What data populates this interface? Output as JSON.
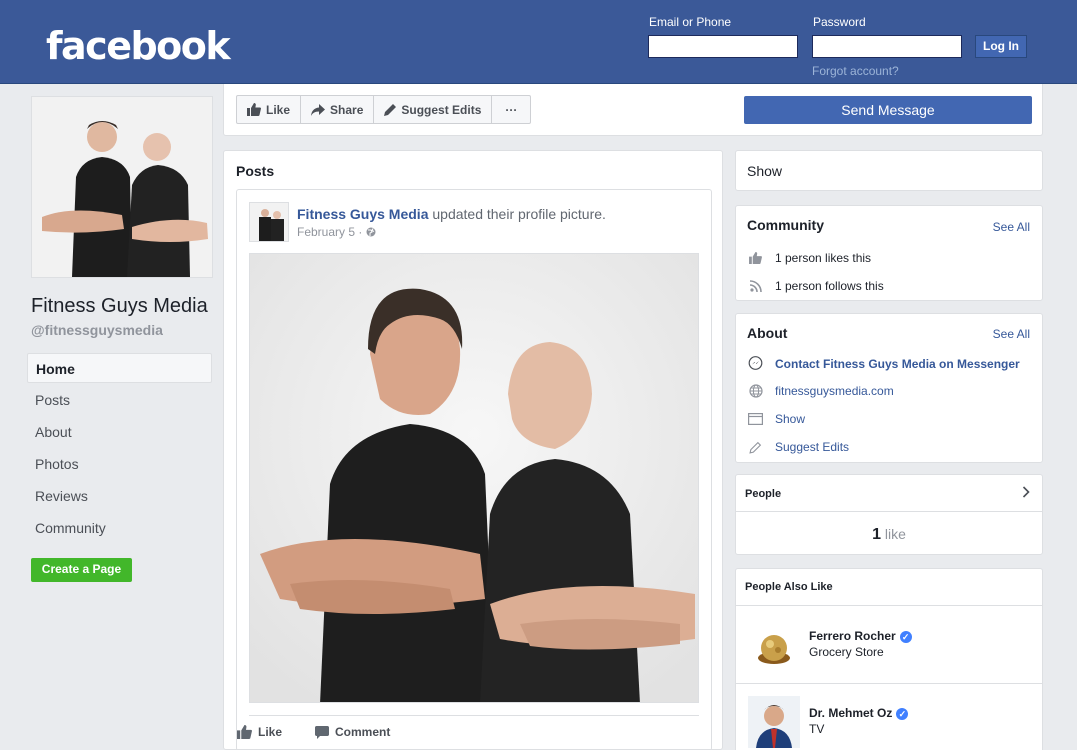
{
  "header": {
    "logo": "facebook",
    "email_label": "Email or Phone",
    "password_label": "Password",
    "login_button": "Log In",
    "forgot_link": "Forgot account?"
  },
  "page": {
    "name": "Fitness Guys Media",
    "handle": "@fitnessguysmedia"
  },
  "nav": {
    "items": [
      "Home",
      "Posts",
      "About",
      "Photos",
      "Reviews",
      "Community"
    ],
    "active": "Home",
    "create_page": "Create a Page"
  },
  "actions": {
    "like": "Like",
    "share": "Share",
    "suggest": "Suggest Edits",
    "more": "···",
    "send_message": "Send Message"
  },
  "posts": {
    "title": "Posts",
    "post": {
      "author": "Fitness Guys Media",
      "action": "updated their profile picture.",
      "date": "February 5 · ",
      "like": "Like",
      "comment": "Comment"
    }
  },
  "right": {
    "show": "Show",
    "community": {
      "title": "Community",
      "see_all": "See All",
      "likes": "1 person likes this",
      "follows": "1 person follows this"
    },
    "about": {
      "title": "About",
      "see_all": "See All",
      "messenger": "Contact Fitness Guys Media on Messenger",
      "website": "fitnessguysmedia.com",
      "show": "Show",
      "suggest": "Suggest Edits"
    },
    "people": {
      "title": "People",
      "count": "1",
      "count_label": "like"
    },
    "also_like": {
      "title": "People Also Like",
      "items": [
        {
          "name": "Ferrero Rocher",
          "category": "Grocery Store"
        },
        {
          "name": "Dr. Mehmet Oz",
          "category": "TV"
        }
      ]
    }
  },
  "colors": {
    "brand_blue": "#3b5998",
    "button_blue": "#4267b2",
    "link_blue": "#365899",
    "green": "#42b72a"
  }
}
